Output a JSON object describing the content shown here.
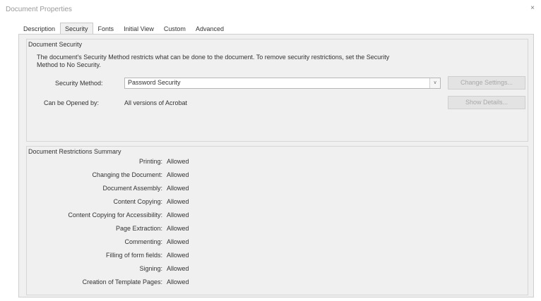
{
  "window": {
    "title": "Document Properties",
    "close_glyph": "×"
  },
  "tabs": [
    {
      "label": "Description"
    },
    {
      "label": "Security"
    },
    {
      "label": "Fonts"
    },
    {
      "label": "Initial View"
    },
    {
      "label": "Custom"
    },
    {
      "label": "Advanced"
    }
  ],
  "active_tab": "Security",
  "security": {
    "group_title": "Document Security",
    "description": "The document's Security Method restricts what can be done to the document. To remove security restrictions, set the Security Method to No Security.",
    "method_label": "Security Method:",
    "method_value": "Password Security",
    "dropdown_glyph": "∨",
    "change_settings_label": "Change Settings...",
    "opened_by_label": "Can be Opened by:",
    "opened_by_value": "All versions of Acrobat",
    "show_details_label": "Show Details..."
  },
  "restrictions": {
    "group_title": "Document Restrictions Summary",
    "rows": [
      {
        "label": "Printing:",
        "value": "Allowed"
      },
      {
        "label": "Changing the Document:",
        "value": "Allowed"
      },
      {
        "label": "Document Assembly:",
        "value": "Allowed"
      },
      {
        "label": "Content Copying:",
        "value": "Allowed"
      },
      {
        "label": "Content Copying for Accessibility:",
        "value": "Allowed"
      },
      {
        "label": "Page Extraction:",
        "value": "Allowed"
      },
      {
        "label": "Commenting:",
        "value": "Allowed"
      },
      {
        "label": "Filling of form fields:",
        "value": "Allowed"
      },
      {
        "label": "Signing:",
        "value": "Allowed"
      },
      {
        "label": "Creation of Template Pages:",
        "value": "Allowed"
      }
    ]
  }
}
